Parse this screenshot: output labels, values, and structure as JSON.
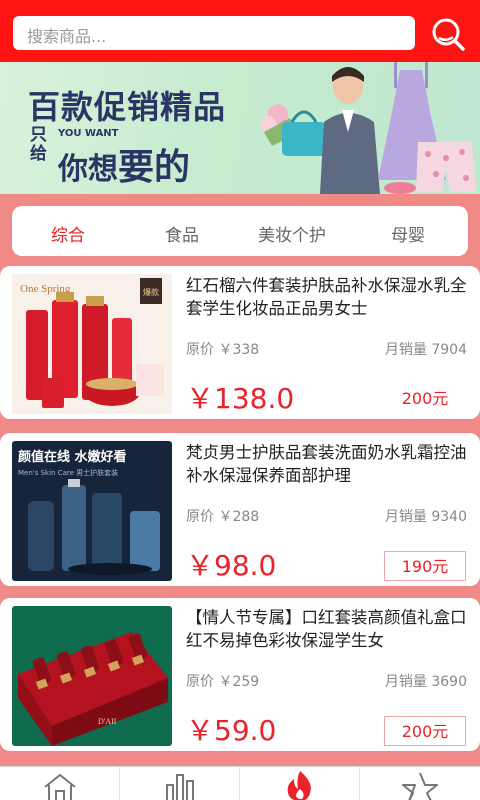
{
  "search": {
    "placeholder": "搜索商品..."
  },
  "banner": {
    "title": "百款促销精品",
    "left_small": "只给",
    "en": "YOU WANT",
    "big_pre": "你想",
    "big_em": "要的"
  },
  "tabs": [
    {
      "label": "综合",
      "active": true
    },
    {
      "label": "食品",
      "active": false
    },
    {
      "label": "美妆个护",
      "active": false
    },
    {
      "label": "母婴",
      "active": false
    }
  ],
  "products": [
    {
      "title": "红石榴六件套装护肤品补水保湿水乳全套学生化妆品正品男女士",
      "orig_price": "原价 ￥338",
      "monthly_sales": "月销量 7904",
      "price": "￥138.0",
      "coupon": "200元",
      "thumb_text": "One Spring",
      "thumb_tag": "爆款"
    },
    {
      "title": "梵贞男士护肤品套装洗面奶水乳霜控油补水保湿保养面部护理",
      "orig_price": "原价 ￥288",
      "monthly_sales": "月销量 9340",
      "price": "￥98.0",
      "coupon": "190元",
      "thumb_text": "颜值在线 水嫩好看",
      "thumb_sub": "Men's Skin Care 男士护肤套装"
    },
    {
      "title": "【情人节专属】口红套装高颜值礼盒口红不易掉色彩妆保湿学生女",
      "orig_price": "原价 ￥259",
      "monthly_sales": "月销量 3690",
      "price": "￥59.0",
      "coupon": "200元",
      "thumb_text": "D'AII"
    }
  ],
  "nav": [
    {
      "icon": "home-icon"
    },
    {
      "icon": "chart-icon"
    },
    {
      "icon": "fire-icon"
    },
    {
      "icon": "star-icon"
    }
  ],
  "colors": {
    "accent": "#ff1414",
    "price": "#e8232a",
    "background": "#f08a86"
  }
}
